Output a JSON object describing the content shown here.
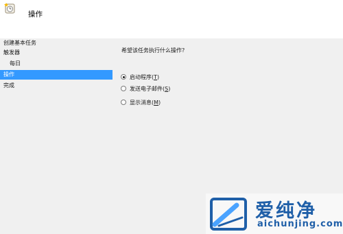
{
  "header": {
    "title": "操作",
    "icon": "task-wizard-icon"
  },
  "steps": [
    {
      "label": "创建基本任务",
      "active": false
    },
    {
      "label": "触发器",
      "active": false
    },
    {
      "label": "每日",
      "active": false
    },
    {
      "label": "操作",
      "active": true
    },
    {
      "label": "完成",
      "active": false
    }
  ],
  "content": {
    "question": "希望该任务执行什么操作?",
    "options": [
      {
        "label": "启动程序(",
        "mnemonic": "T",
        "suffix": ")",
        "checked": true
      },
      {
        "label": "发送电子邮件(",
        "mnemonic": "S",
        "suffix": ")",
        "checked": false
      },
      {
        "label": "显示消息(",
        "mnemonic": "M",
        "suffix": ")",
        "checked": false
      }
    ]
  },
  "watermark": {
    "title": "爱纯净",
    "url": "aichunjing.com"
  },
  "colors": {
    "selection": "#3399ff",
    "panel_bg": "#f0f0f0",
    "watermark_text": "#1f5fa8"
  }
}
